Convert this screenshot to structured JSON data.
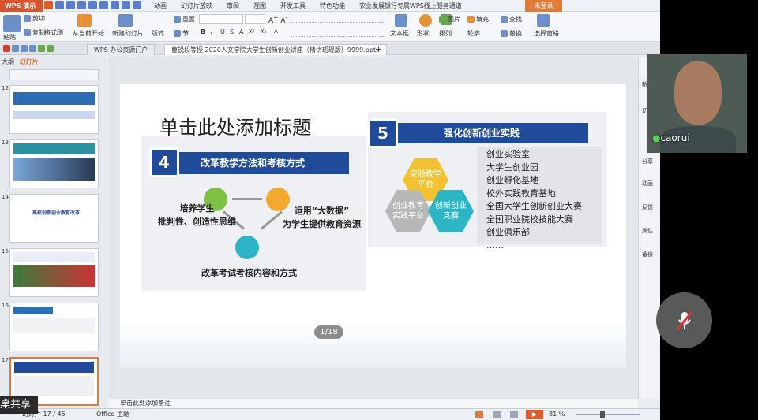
{
  "app": {
    "name": "WPS 演示",
    "login": "未登录"
  },
  "menus": [
    "动画",
    "幻灯片放映",
    "审阅",
    "视图",
    "开发工具",
    "特色功能",
    "农业发展银行专属WPS线上服务通道"
  ],
  "ribbon": {
    "paste": "粘贴",
    "cut": "剪切",
    "copy": "复制",
    "format_painter": "格式刷",
    "from_start": "从当前开始",
    "new_slide": "新建幻灯片",
    "layout": "版式",
    "section": "节",
    "reset": "重置",
    "font_name": "",
    "font_size": "",
    "bold": "B",
    "italic": "I",
    "underline": "U",
    "strike": "S",
    "textbox": "文本框",
    "shape": "形状",
    "arrange": "排列",
    "outline": "轮廓",
    "picture": "图片",
    "fill": "填充",
    "find": "查找",
    "replace": "替换",
    "select_pane": "选择窗格"
  },
  "tabs": [
    {
      "label": "WPS 办公资源门户",
      "active": false
    },
    {
      "label": "曹锐段等授 2020人文学院大学生创新创业讲座（精讲班现版）9999.pptx",
      "active": true
    }
  ],
  "thumb_panel": {
    "outline_tab": "大纲",
    "slides_tab": "幻灯片"
  },
  "thumbnails": [
    {
      "num": "12",
      "title": ""
    },
    {
      "num": "13",
      "title": ""
    },
    {
      "num": "14",
      "title": "高校创新创业教育改革"
    },
    {
      "num": "15",
      "title": ""
    },
    {
      "num": "16",
      "title": ""
    },
    {
      "num": "17",
      "title": ""
    }
  ],
  "slide": {
    "title": "单击此处添加标题",
    "left": {
      "num": "4",
      "header": "改革教学方法和考核方式",
      "node1": "培养学生\n批判性、创造性思维",
      "node2": "运用“大数据”\n为学生提供教育资源",
      "node3": "改革考试考核内容和方式"
    },
    "right": {
      "num": "5",
      "header": "强化创新创业实践",
      "hex1": "实验教学\n平台",
      "hex2": "创业教育\n实践平台",
      "hex3": "创新创业\n竞赛",
      "items": [
        "创业实验室",
        "大学生创业园",
        "创业孵化基地",
        "校外实践教育基地",
        "全国大学生创新创业大赛",
        "全国职业院校技能大赛",
        "创业俱乐部",
        "……"
      ]
    },
    "page_badge": "1/18"
  },
  "notes": "单击此处添加备注",
  "status": {
    "page": "幻灯片 17 / 45",
    "theme": "Office 主题",
    "zoom": "81 %",
    "share_label": "桌共享"
  },
  "right_panel": [
    "新",
    "切",
    "分享",
    "动画",
    "反馈",
    "属性",
    "备份"
  ],
  "video": {
    "name": "caorui",
    "mic_muted": true
  },
  "colors": {
    "accent": "#1f4b9a",
    "brand": "#d9532c",
    "hex_yellow": "#f2c230",
    "hex_gray": "#b7b7b7",
    "hex_teal": "#2bb5c5"
  }
}
